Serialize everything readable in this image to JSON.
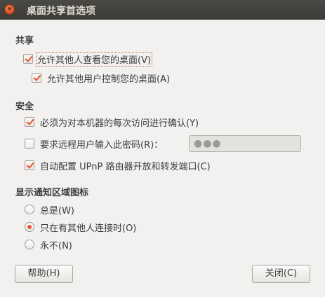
{
  "window": {
    "title": "桌面共享首选项",
    "close_icon": "×"
  },
  "sharing": {
    "header": "共享",
    "allow_view": {
      "label": "允许其他人查看您的桌面(V)",
      "checked": true
    },
    "allow_control": {
      "label": "允许其他用户控制您的桌面(A)",
      "checked": true
    }
  },
  "security": {
    "header": "安全",
    "confirm_access": {
      "label": "必须为对本机器的每次访问进行确认(Y)",
      "checked": true
    },
    "require_password": {
      "label": "要求远程用户输入此密码(R)：",
      "checked": false
    },
    "password_value": "●●●",
    "upnp": {
      "label": "自动配置 UPnP 路由器开放和转发端口(C)",
      "checked": true
    }
  },
  "notification": {
    "header": "显示通知区域图标",
    "options": [
      {
        "label": "总是(W)",
        "selected": false
      },
      {
        "label": "只在有其他人连接时(O)",
        "selected": true
      },
      {
        "label": "永不(N)",
        "selected": false
      }
    ]
  },
  "buttons": {
    "help": "帮助(H)",
    "close": "关闭(C)"
  },
  "colors": {
    "accent": "#e0562d",
    "titlebar": "#3c3b37",
    "background": "#f2f1f0"
  }
}
